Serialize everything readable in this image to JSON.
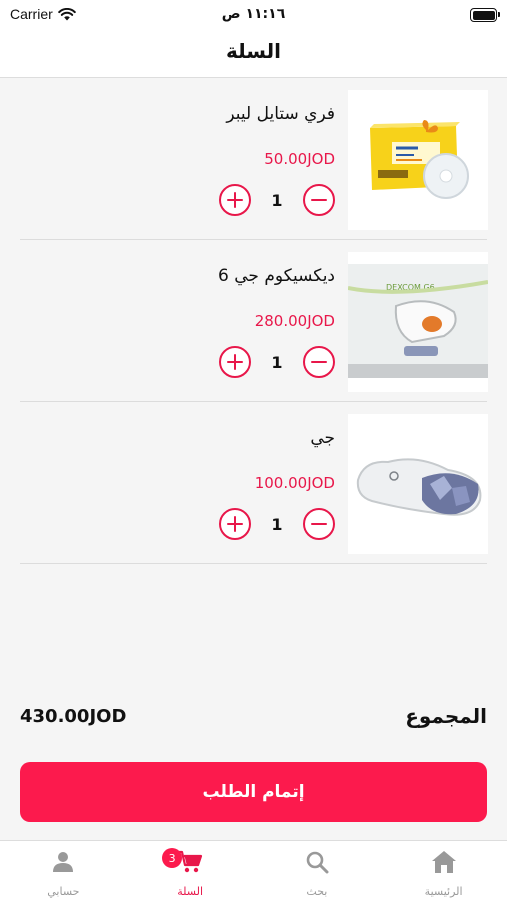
{
  "status_bar": {
    "carrier": "Carrier",
    "time": "١١:١٦ ص"
  },
  "nav": {
    "title": "السلة"
  },
  "cart": {
    "items": [
      {
        "name": "فري ستايل ليبر",
        "price": "50.00JOD",
        "quantity": "1"
      },
      {
        "name": "ديكسيكوم جي 6",
        "price": "280.00JOD",
        "quantity": "1",
        "image_text": "DEXCOM G6"
      },
      {
        "name": "جي",
        "price": "100.00JOD",
        "quantity": "1"
      }
    ]
  },
  "summary": {
    "total_label": "المجموع",
    "total_value": "430.00JOD"
  },
  "checkout": {
    "label": "إتمام الطلب"
  },
  "tabs": [
    {
      "label": "حسابي",
      "icon": "person-icon"
    },
    {
      "label": "السلة",
      "icon": "cart-icon",
      "badge": "3"
    },
    {
      "label": "بحث",
      "icon": "search-icon"
    },
    {
      "label": "الرئيسية",
      "icon": "home-icon"
    }
  ],
  "colors": {
    "accent": "#fc1a4d",
    "price": "#e8174a",
    "background": "#f5f5f5",
    "tab_inactive": "#999999"
  }
}
